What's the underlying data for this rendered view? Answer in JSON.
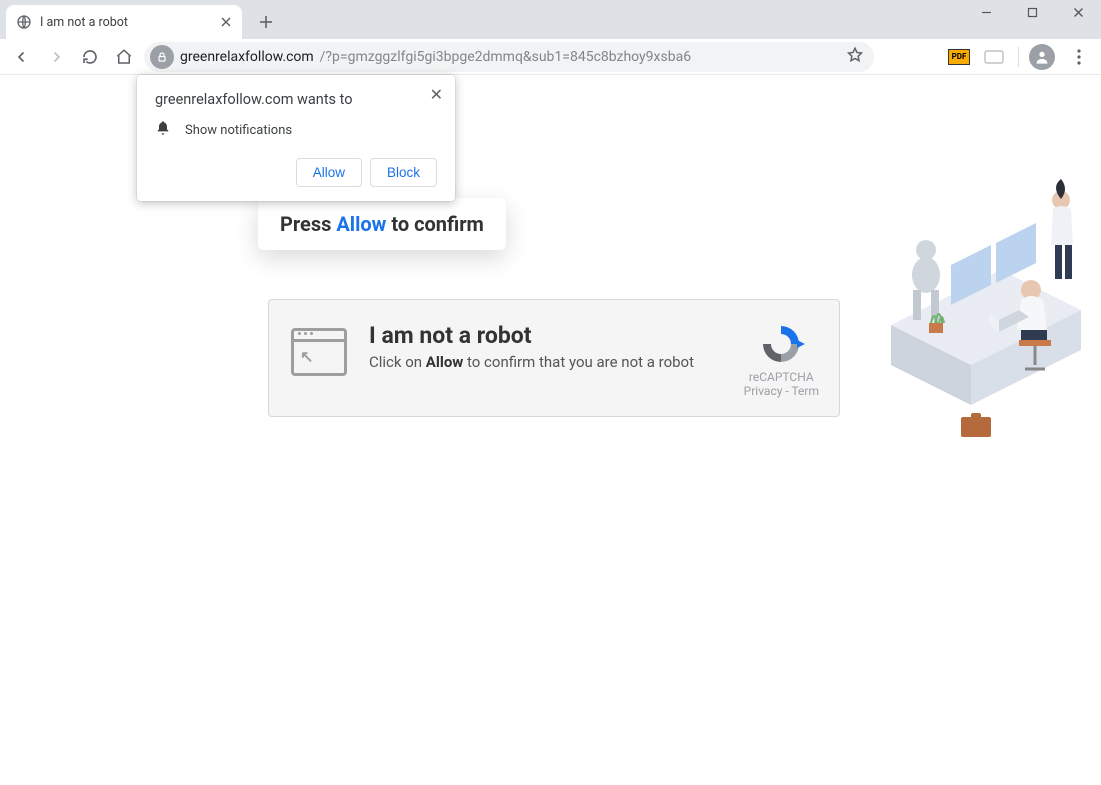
{
  "window_controls": {
    "minimize": "min",
    "maximize": "max",
    "close": "close"
  },
  "tab": {
    "title": "I am not a robot"
  },
  "toolbar": {
    "url_host": "greenrelaxfollow.com",
    "url_rest": "/?p=gmzggzlfgi5gi3bpge2dmmq&sub1=845c8bzhoy9xsba6",
    "ext_pdf_label": "PDF"
  },
  "permission": {
    "title": "greenrelaxfollow.com wants to",
    "item": "Show notifications",
    "allow": "Allow",
    "block": "Block"
  },
  "bubble": {
    "prefix": "Press ",
    "allow": "Allow",
    "suffix": " to confirm"
  },
  "captcha": {
    "heading": "I am not a robot",
    "line_prefix": "Click on ",
    "line_bold": "Allow",
    "line_suffix": " to confirm that you are not a robot",
    "badge": "reCAPTCHA",
    "privacy": "Privacy",
    "terms": "Term"
  }
}
